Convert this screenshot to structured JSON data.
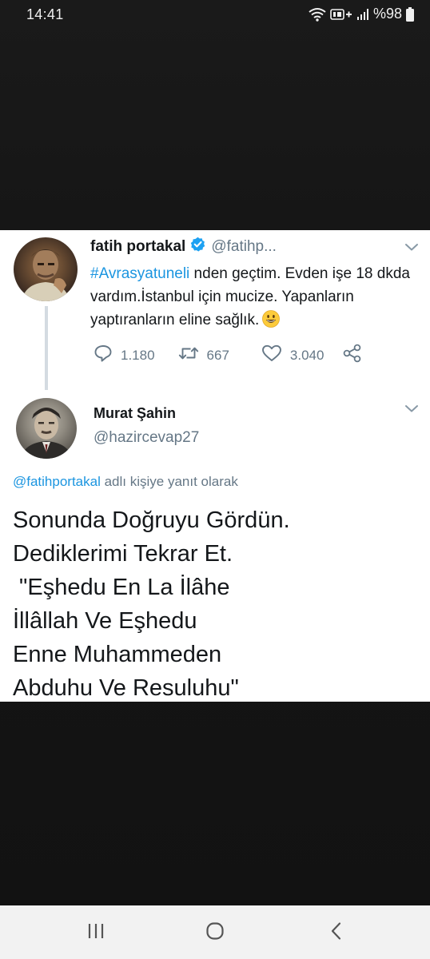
{
  "status_bar": {
    "time": "14:41",
    "battery_percent": "%98",
    "icons": [
      "wifi-icon",
      "volte-icon",
      "signal-icon",
      "battery-icon"
    ]
  },
  "tweet": {
    "author_name": "fatih portakal",
    "author_handle": "@fatihp...",
    "hashtag": "#Avrasyatuneli",
    "text_after_hashtag": " nden geçtim. Evden işe 18 dkda vardım.İstanbul için mucize. Yapanların yaptıranların eline sağlık.",
    "emoji": "grinning-face-emoji",
    "reply_count": "1.180",
    "retweet_count": "667",
    "like_count": "3.040"
  },
  "reply": {
    "author_name": "Murat Şahin",
    "author_handle": "@hazircevap27",
    "reply_to_mention": "@fatihportakal",
    "reply_to_suffix": " adlı kişiye yanıt olarak",
    "lines": [
      "Sonunda Doğruyu Gördün.",
      "Dediklerimi Tekrar Et.",
      " \"Eşhedu En La İlâhe",
      "İllâllah Ve Eşhedu",
      "Enne Muhammeden",
      "Abduhu Ve Resuluhu\""
    ]
  },
  "colors": {
    "link": "#1b95e0",
    "muted": "#657786",
    "text": "#14171a",
    "verified": "#1da1f2"
  }
}
